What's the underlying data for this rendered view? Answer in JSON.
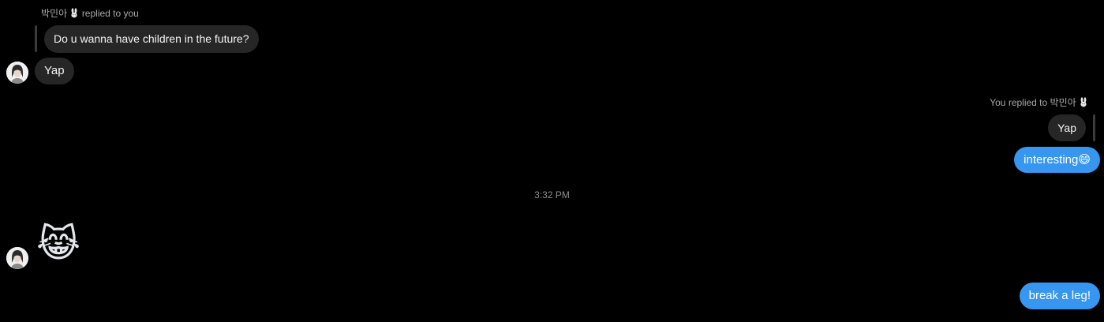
{
  "messages": {
    "m1_reply_meta": {
      "name": "박민아",
      "suffix": "replied to you"
    },
    "m1_quoted_text": "Do u wanna have children in the future?",
    "m1_text": "Yap",
    "m2_reply_meta": {
      "prefix": "You replied to",
      "name": "박민아"
    },
    "m2_quoted_text": "Yap",
    "m2_text": "interesting😄",
    "timestamp": "3:32 PM",
    "m3_emoji": "😹",
    "m4_text": "break a leg!"
  },
  "colors": {
    "background": "#000000",
    "incoming_bubble": "#262626",
    "outgoing_bubble": "#3797f0",
    "meta_text": "#a8a8a8"
  },
  "icons": {
    "name_badge": "rabbit-icon"
  }
}
